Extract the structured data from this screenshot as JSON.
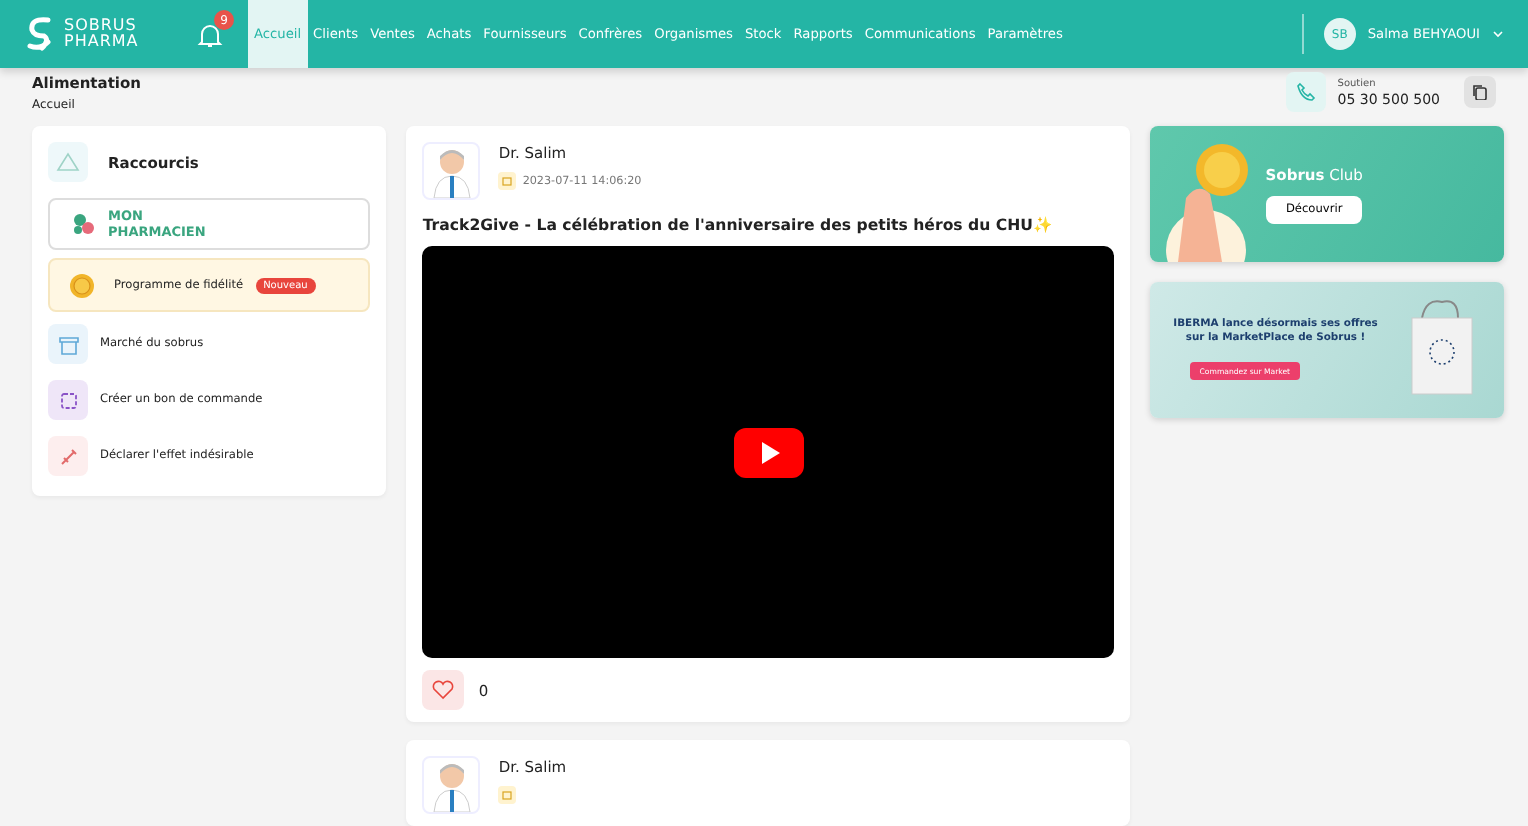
{
  "header": {
    "logo_line1": "SOBRUS",
    "logo_line2": "PHARMA",
    "notification_count": "9",
    "nav": [
      {
        "label": "Accueil",
        "selected": true
      },
      {
        "label": "Clients",
        "selected": false
      },
      {
        "label": "Ventes",
        "selected": false
      },
      {
        "label": "Achats",
        "selected": false
      },
      {
        "label": "Fournisseurs",
        "selected": false
      },
      {
        "label": "Confrères",
        "selected": false
      },
      {
        "label": "Organismes",
        "selected": false
      },
      {
        "label": "Stock",
        "selected": false
      },
      {
        "label": "Rapports",
        "selected": false
      },
      {
        "label": "Communications",
        "selected": false
      },
      {
        "label": "Paramètres",
        "selected": false
      }
    ],
    "user": {
      "initials": "SB",
      "name": "Salma BEHYAOUI"
    }
  },
  "breadcrumb": {
    "title": "Alimentation",
    "path": "Accueil"
  },
  "support": {
    "label": "Soutien",
    "phone": "05 30 500 500"
  },
  "shortcuts": {
    "title": "Raccourcis",
    "partner_line1": "MON",
    "partner_line2": "PHARMACIEN",
    "items": [
      {
        "kind": "loyalty",
        "label": "Programme de fidélité",
        "badge": "Nouveau"
      },
      {
        "kind": "market",
        "label": "Marché du sobrus"
      },
      {
        "kind": "order",
        "label": "Créer un bon de commande"
      },
      {
        "kind": "adverse",
        "label": "Déclarer l'effet indésirable"
      }
    ]
  },
  "posts": [
    {
      "author": "Dr. Salim",
      "date": "2023-07-11 14:06:20",
      "title": "Track2Give - La célébration de l'anniversaire des petits héros du CHU✨",
      "likes": "0",
      "liked": false
    },
    {
      "author": "Dr. Salim"
    }
  ],
  "banners": [
    {
      "kind": "club",
      "title_bold": "Sobrus",
      "title_rest": "Club",
      "button": "Découvrir"
    },
    {
      "kind": "promo",
      "text": "IBERMA lance désormais ses offres sur la MarketPlace de Sobrus !",
      "button": "Commandez sur Market"
    }
  ]
}
